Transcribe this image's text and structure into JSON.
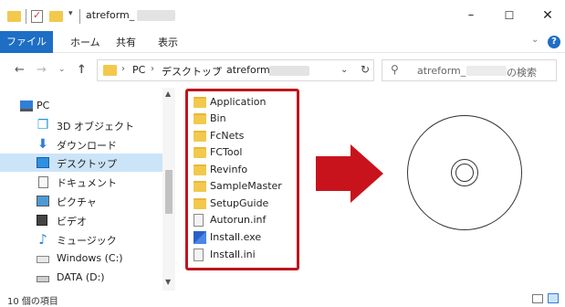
{
  "window": {
    "title": "atreform_",
    "min_glyph": "–",
    "max_glyph": "☐",
    "close_glyph": "✕"
  },
  "ribbon": {
    "tabs": [
      "ファイル",
      "ホーム",
      "共有",
      "表示"
    ]
  },
  "address": {
    "segments": [
      "PC",
      "デスクトップ",
      "atreform_"
    ],
    "sep": "›",
    "search_prefix": "atreform_",
    "search_suffix": "の検索"
  },
  "nav": {
    "back": "←",
    "forward": "→",
    "recent": "⌄",
    "up": "↑"
  },
  "navpane": {
    "items": [
      {
        "label": "PC",
        "icon": "pc-icon"
      },
      {
        "label": "3D オブジェクト",
        "icon": "3d-objects-icon"
      },
      {
        "label": "ダウンロード",
        "icon": "download-icon"
      },
      {
        "label": "デスクトップ",
        "icon": "desktop-icon",
        "selected": true
      },
      {
        "label": "ドキュメント",
        "icon": "documents-icon"
      },
      {
        "label": "ピクチャ",
        "icon": "pictures-icon"
      },
      {
        "label": "ビデオ",
        "icon": "videos-icon"
      },
      {
        "label": "ミュージック",
        "icon": "music-icon"
      },
      {
        "label": "Windows (C:)",
        "icon": "drive-c-icon"
      },
      {
        "label": "DATA (D:)",
        "icon": "drive-d-icon"
      }
    ]
  },
  "files": [
    {
      "name": "Application",
      "type": "folder"
    },
    {
      "name": "Bin",
      "type": "folder"
    },
    {
      "name": "FcNets",
      "type": "folder"
    },
    {
      "name": "FCTool",
      "type": "folder"
    },
    {
      "name": "Revinfo",
      "type": "folder"
    },
    {
      "name": "SampleMaster",
      "type": "folder"
    },
    {
      "name": "SetupGuide",
      "type": "folder"
    },
    {
      "name": "Autorun.inf",
      "type": "inf"
    },
    {
      "name": "Install.exe",
      "type": "exe"
    },
    {
      "name": "Install.ini",
      "type": "ini"
    }
  ],
  "status": {
    "item_count": "10 個の項目"
  },
  "colors": {
    "accent": "#1d6ec4",
    "highlight_red": "#c0151f",
    "folder_yellow": "#f2c94c",
    "selected_bg": "#cce4f7"
  }
}
